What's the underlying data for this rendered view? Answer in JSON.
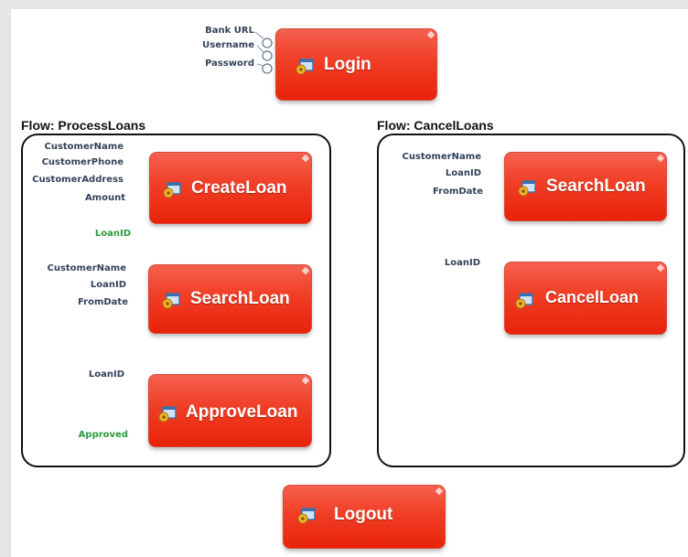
{
  "login": {
    "label": "Login",
    "inputs": [
      "Bank URL",
      "Username",
      "Password"
    ]
  },
  "logout": {
    "label": "Logout"
  },
  "flows": [
    {
      "title": "Flow: ProcessLoans",
      "steps": [
        {
          "label": "CreateLoan",
          "inputs": [
            "CustomerName",
            "CustomerPhone",
            "CustomerAddress",
            "Amount"
          ],
          "outputs": [
            "LoanID"
          ]
        },
        {
          "label": "SearchLoan",
          "inputs": [
            "CustomerName",
            "LoanID",
            "FromDate"
          ],
          "outputs": []
        },
        {
          "label": "ApproveLoan",
          "inputs": [
            "LoanID"
          ],
          "outputs": [
            "Approved"
          ]
        }
      ]
    },
    {
      "title": "Flow: CancelLoans",
      "steps": [
        {
          "label": "SearchLoan",
          "inputs": [
            "CustomerName",
            "LoanID",
            "FromDate"
          ],
          "outputs": []
        },
        {
          "label": "CancelLoan",
          "inputs": [
            "LoanID"
          ],
          "outputs": []
        }
      ]
    }
  ],
  "colors": {
    "box_red": "#ee3a22",
    "input_text": "#33425b",
    "output_text": "#2a9b3a"
  },
  "icons": {
    "action": "gear-window-icon"
  }
}
